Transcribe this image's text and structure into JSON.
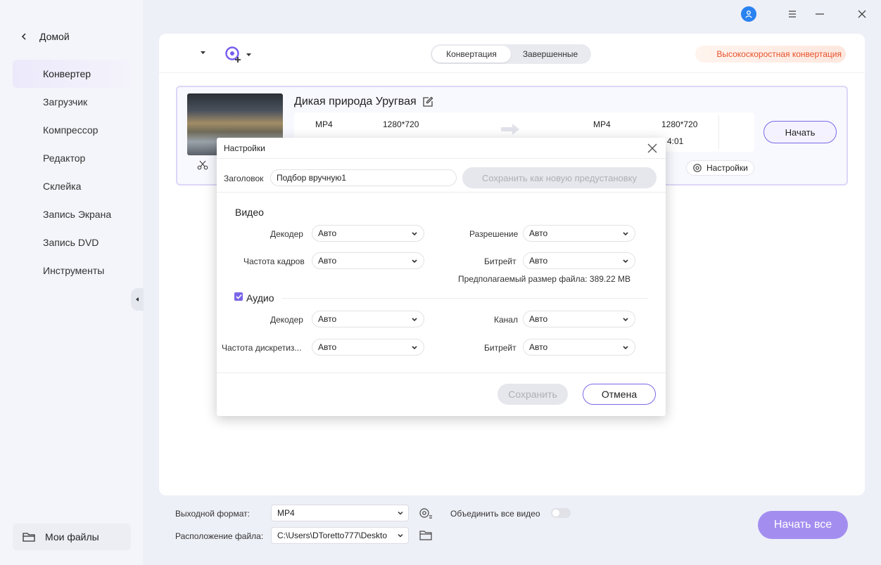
{
  "sidebar": {
    "home_label": "Домой",
    "items": [
      {
        "label": "Конвертер",
        "active": true
      },
      {
        "label": "Загрузчик"
      },
      {
        "label": "Компрессор"
      },
      {
        "label": "Редактор"
      },
      {
        "label": "Склейка"
      },
      {
        "label": "Запись Экрана"
      },
      {
        "label": "Запись DVD"
      },
      {
        "label": "Инструменты"
      }
    ],
    "my_files_label": "Мои файлы"
  },
  "header": {
    "tabs": [
      "Конвертация",
      "Завершенные"
    ],
    "high_speed_label": "Высокоскоростная конвертация"
  },
  "file": {
    "title": "Дикая природа Уругвая",
    "src_format": "MP4",
    "src_resolution": "1280*720",
    "dst_format": "MP4",
    "dst_resolution": "1280*720",
    "dst_duration_partial": "4:01",
    "start_label": "Начать",
    "settings_label": "Настройки"
  },
  "dialog": {
    "title": "Настройки",
    "preset_label": "Заголовок",
    "preset_value": "Подбор вручную1",
    "save_new_label": "Сохранить как новую предустановку",
    "video": {
      "section": "Видео",
      "decoder_label": "Декодер",
      "decoder_value": "Авто",
      "framerate_label": "Частота кадров",
      "framerate_value": "Авто",
      "resolution_label": "Разрешение",
      "resolution_value": "Авто",
      "bitrate_label": "Битрейт",
      "bitrate_value": "Авто",
      "est_size": "Предполагаемый размер файла: 389.22 MB"
    },
    "audio": {
      "section": "Аудио",
      "checked": true,
      "decoder_label": "Декодер",
      "decoder_value": "Авто",
      "samplerate_label": "Частота дискретиз...",
      "samplerate_value": "Авто",
      "channel_label": "Канал",
      "channel_value": "Авто",
      "bitrate_label": "Битрейт",
      "bitrate_value": "Авто"
    },
    "save_label": "Сохранить",
    "cancel_label": "Отмена"
  },
  "bottom": {
    "output_format_label": "Выходной формат:",
    "output_format_value": "MP4",
    "merge_label": "Объединить все видео",
    "location_label": "Расположение файла:",
    "location_value": "C:\\Users\\DToretto777\\Deskto",
    "start_all_label": "Начать все"
  },
  "colors": {
    "accent": "#7a6ae6",
    "start_all_bg": "#a38ef0",
    "high_speed_text": "#e8512b",
    "avatar": "#2a82f0"
  }
}
